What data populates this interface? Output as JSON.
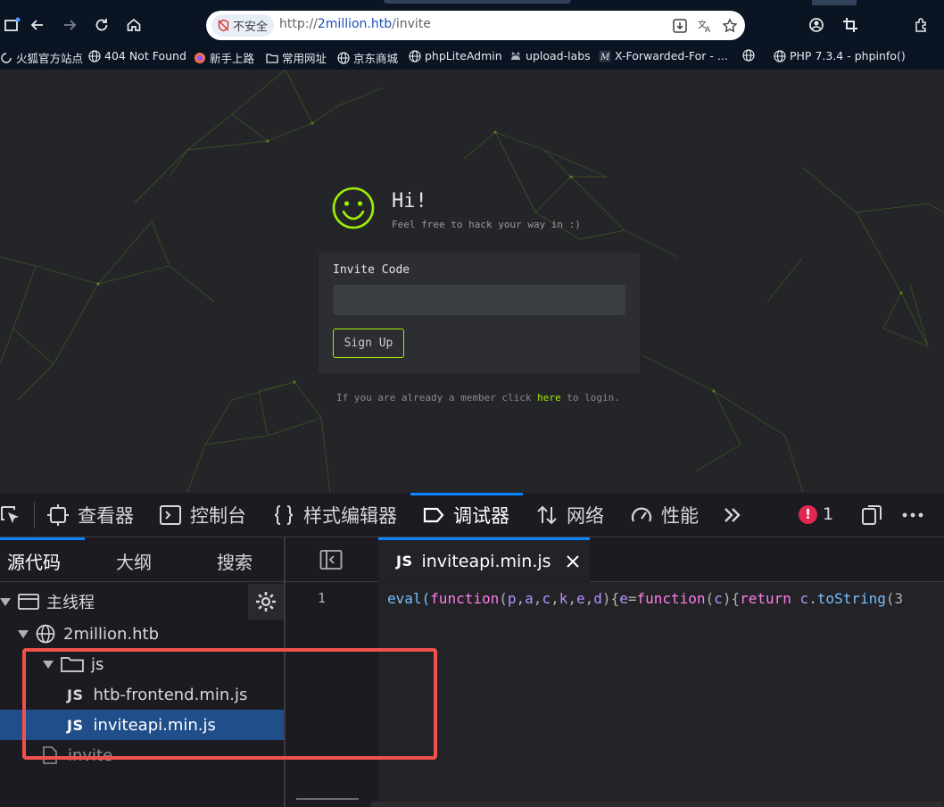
{
  "browser": {
    "url_scheme": "http://",
    "url_host": "2million.htb",
    "url_path": "/invite",
    "security_label": "不安全",
    "bookmarks": [
      {
        "label": "火狐官方站点",
        "icon": "firefox-icon"
      },
      {
        "label": "404 Not Found",
        "icon": "globe-icon"
      },
      {
        "label": "新手上路",
        "icon": "firefox-icon"
      },
      {
        "label": "常用网址",
        "icon": "folder-icon"
      },
      {
        "label": "京东商城",
        "icon": "globe-icon"
      },
      {
        "label": "phpLiteAdmin",
        "icon": "globe-icon"
      },
      {
        "label": "upload-labs",
        "icon": "cat-icon"
      },
      {
        "label": "X-Forwarded-For - ...",
        "icon": "m-icon"
      },
      {
        "label": "",
        "icon": "globe-icon"
      },
      {
        "label": "PHP 7.3.4 - phpinfo()",
        "icon": "globe-icon"
      }
    ]
  },
  "page": {
    "title": "Hi!",
    "subtitle": "Feel free to hack your way in :)",
    "invite_label": "Invite Code",
    "invite_value": "",
    "signup_label": "Sign Up",
    "login_prefix": "If you are already a member click ",
    "login_link": "here",
    "login_suffix": " to login.",
    "accent_color": "#9fef00"
  },
  "devtools": {
    "tabs": [
      {
        "label": "查看器",
        "icon": "inspector-icon"
      },
      {
        "label": "控制台",
        "icon": "console-icon"
      },
      {
        "label": "样式编辑器",
        "icon": "style-editor-icon"
      },
      {
        "label": "调试器",
        "icon": "debugger-icon",
        "active": true
      },
      {
        "label": "网络",
        "icon": "network-icon"
      },
      {
        "label": "性能",
        "icon": "performance-icon"
      }
    ],
    "error_count": "1",
    "sources_tabs": [
      "源代码",
      "大纲",
      "搜索"
    ],
    "tree": {
      "main_thread": "主线程",
      "domain": "2million.htb",
      "folder": "js",
      "file_badge": "JS",
      "files": [
        "htb-frontend.min.js",
        "inviteapi.min.js"
      ],
      "page_item": "invite"
    },
    "editor": {
      "tab_badge": "JS",
      "tab_label": "inviteapi.min.js",
      "line_number": "1",
      "code_parts": [
        "eval(",
        "function",
        "(",
        "p",
        ",",
        "a",
        ",",
        "c",
        ",",
        "k",
        ",",
        "e",
        ",",
        "d",
        "){",
        "e",
        "=",
        "function",
        "(",
        "c",
        "){",
        "return",
        " ",
        "c",
        ".",
        "toString",
        "(3"
      ]
    }
  }
}
